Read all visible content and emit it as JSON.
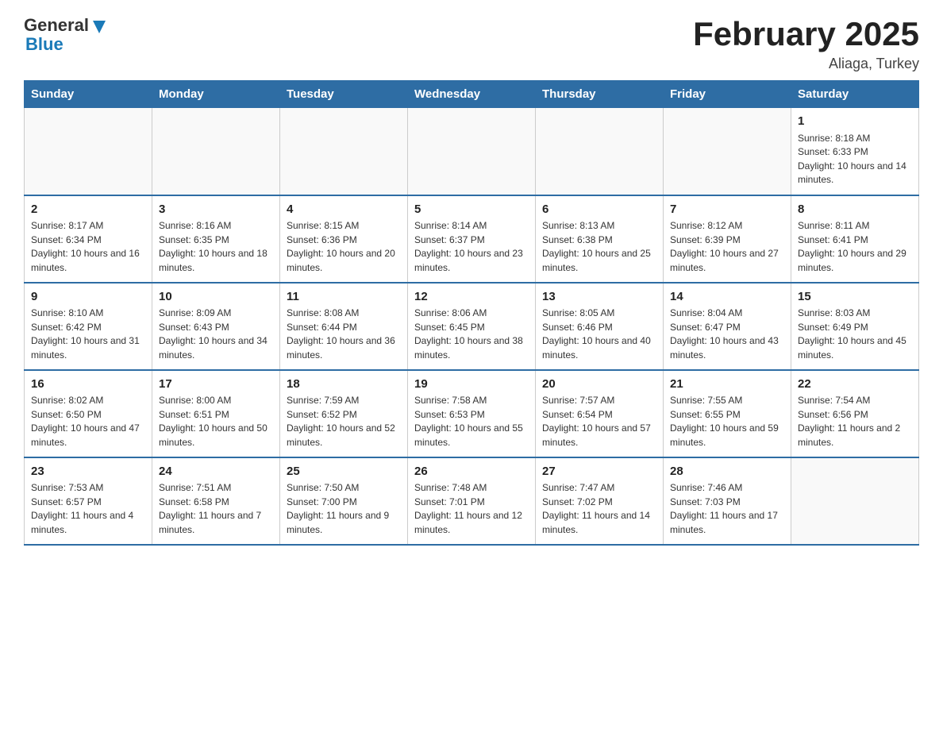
{
  "header": {
    "logo_general": "General",
    "logo_blue": "Blue",
    "month_title": "February 2025",
    "location": "Aliaga, Turkey"
  },
  "days_of_week": [
    "Sunday",
    "Monday",
    "Tuesday",
    "Wednesday",
    "Thursday",
    "Friday",
    "Saturday"
  ],
  "weeks": [
    [
      {
        "day": "",
        "info": ""
      },
      {
        "day": "",
        "info": ""
      },
      {
        "day": "",
        "info": ""
      },
      {
        "day": "",
        "info": ""
      },
      {
        "day": "",
        "info": ""
      },
      {
        "day": "",
        "info": ""
      },
      {
        "day": "1",
        "info": "Sunrise: 8:18 AM\nSunset: 6:33 PM\nDaylight: 10 hours and 14 minutes."
      }
    ],
    [
      {
        "day": "2",
        "info": "Sunrise: 8:17 AM\nSunset: 6:34 PM\nDaylight: 10 hours and 16 minutes."
      },
      {
        "day": "3",
        "info": "Sunrise: 8:16 AM\nSunset: 6:35 PM\nDaylight: 10 hours and 18 minutes."
      },
      {
        "day": "4",
        "info": "Sunrise: 8:15 AM\nSunset: 6:36 PM\nDaylight: 10 hours and 20 minutes."
      },
      {
        "day": "5",
        "info": "Sunrise: 8:14 AM\nSunset: 6:37 PM\nDaylight: 10 hours and 23 minutes."
      },
      {
        "day": "6",
        "info": "Sunrise: 8:13 AM\nSunset: 6:38 PM\nDaylight: 10 hours and 25 minutes."
      },
      {
        "day": "7",
        "info": "Sunrise: 8:12 AM\nSunset: 6:39 PM\nDaylight: 10 hours and 27 minutes."
      },
      {
        "day": "8",
        "info": "Sunrise: 8:11 AM\nSunset: 6:41 PM\nDaylight: 10 hours and 29 minutes."
      }
    ],
    [
      {
        "day": "9",
        "info": "Sunrise: 8:10 AM\nSunset: 6:42 PM\nDaylight: 10 hours and 31 minutes."
      },
      {
        "day": "10",
        "info": "Sunrise: 8:09 AM\nSunset: 6:43 PM\nDaylight: 10 hours and 34 minutes."
      },
      {
        "day": "11",
        "info": "Sunrise: 8:08 AM\nSunset: 6:44 PM\nDaylight: 10 hours and 36 minutes."
      },
      {
        "day": "12",
        "info": "Sunrise: 8:06 AM\nSunset: 6:45 PM\nDaylight: 10 hours and 38 minutes."
      },
      {
        "day": "13",
        "info": "Sunrise: 8:05 AM\nSunset: 6:46 PM\nDaylight: 10 hours and 40 minutes."
      },
      {
        "day": "14",
        "info": "Sunrise: 8:04 AM\nSunset: 6:47 PM\nDaylight: 10 hours and 43 minutes."
      },
      {
        "day": "15",
        "info": "Sunrise: 8:03 AM\nSunset: 6:49 PM\nDaylight: 10 hours and 45 minutes."
      }
    ],
    [
      {
        "day": "16",
        "info": "Sunrise: 8:02 AM\nSunset: 6:50 PM\nDaylight: 10 hours and 47 minutes."
      },
      {
        "day": "17",
        "info": "Sunrise: 8:00 AM\nSunset: 6:51 PM\nDaylight: 10 hours and 50 minutes."
      },
      {
        "day": "18",
        "info": "Sunrise: 7:59 AM\nSunset: 6:52 PM\nDaylight: 10 hours and 52 minutes."
      },
      {
        "day": "19",
        "info": "Sunrise: 7:58 AM\nSunset: 6:53 PM\nDaylight: 10 hours and 55 minutes."
      },
      {
        "day": "20",
        "info": "Sunrise: 7:57 AM\nSunset: 6:54 PM\nDaylight: 10 hours and 57 minutes."
      },
      {
        "day": "21",
        "info": "Sunrise: 7:55 AM\nSunset: 6:55 PM\nDaylight: 10 hours and 59 minutes."
      },
      {
        "day": "22",
        "info": "Sunrise: 7:54 AM\nSunset: 6:56 PM\nDaylight: 11 hours and 2 minutes."
      }
    ],
    [
      {
        "day": "23",
        "info": "Sunrise: 7:53 AM\nSunset: 6:57 PM\nDaylight: 11 hours and 4 minutes."
      },
      {
        "day": "24",
        "info": "Sunrise: 7:51 AM\nSunset: 6:58 PM\nDaylight: 11 hours and 7 minutes."
      },
      {
        "day": "25",
        "info": "Sunrise: 7:50 AM\nSunset: 7:00 PM\nDaylight: 11 hours and 9 minutes."
      },
      {
        "day": "26",
        "info": "Sunrise: 7:48 AM\nSunset: 7:01 PM\nDaylight: 11 hours and 12 minutes."
      },
      {
        "day": "27",
        "info": "Sunrise: 7:47 AM\nSunset: 7:02 PM\nDaylight: 11 hours and 14 minutes."
      },
      {
        "day": "28",
        "info": "Sunrise: 7:46 AM\nSunset: 7:03 PM\nDaylight: 11 hours and 17 minutes."
      },
      {
        "day": "",
        "info": ""
      }
    ]
  ]
}
